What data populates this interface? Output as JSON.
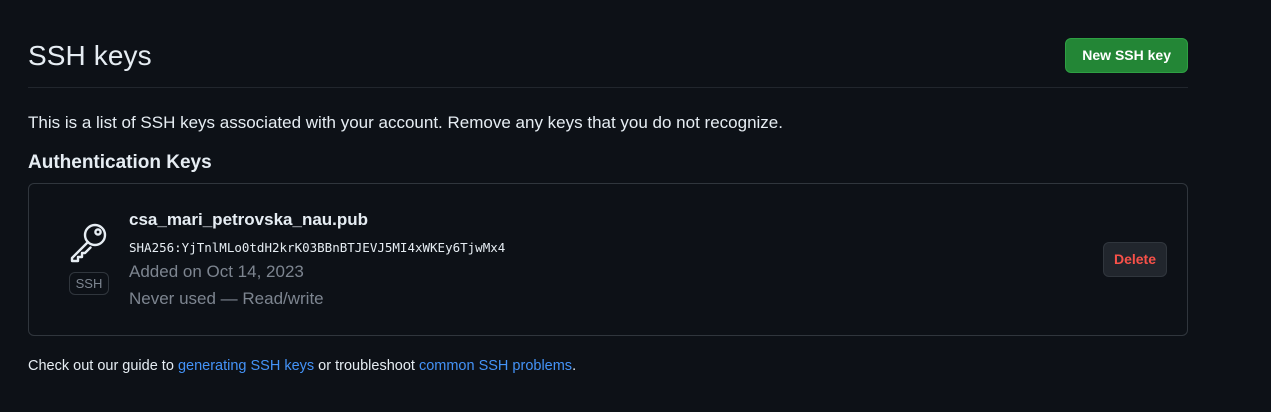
{
  "header": {
    "title": "SSH keys",
    "new_key_label": "New SSH key"
  },
  "description": "This is a list of SSH keys associated with your account. Remove any keys that you do not recognize.",
  "section_heading": "Authentication Keys",
  "keys": [
    {
      "title": "csa_mari_petrovska_nau.pub",
      "fingerprint": "SHA256:YjTnlMLo0tdH2krK03BBnBTJEVJ5MI4xWKEy6TjwMx4",
      "added": "Added on Oct 14, 2023",
      "usage": "Never used — Read/write",
      "type_badge": "SSH",
      "icon": "key-icon",
      "delete_label": "Delete"
    }
  ],
  "footer": {
    "prefix": "Check out our guide to ",
    "link1": "generating SSH keys",
    "middle": " or troubleshoot ",
    "link2": "common SSH problems",
    "suffix": "."
  },
  "colors": {
    "background": "#0d1117",
    "primary_button": "#238636",
    "danger_text": "#f85149",
    "link": "#4493f8",
    "muted_text": "#7d8590",
    "border": "#30363d"
  }
}
